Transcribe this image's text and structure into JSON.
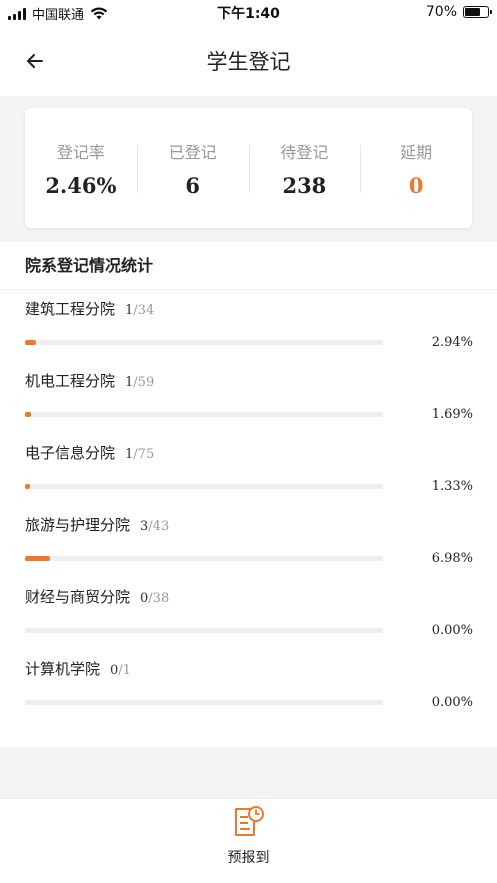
{
  "status_bar": {
    "carrier": "中国联通",
    "time": "下午1:40",
    "battery": "70%",
    "battery_level": 0.7
  },
  "nav": {
    "title": "学生登记",
    "back_icon": "arrow-left-icon"
  },
  "summary": {
    "rate_label": "登记率",
    "rate_value": "2.46%",
    "registered_label": "已登记",
    "registered_value": "6",
    "pending_label": "待登记",
    "pending_value": "238",
    "delayed_label": "延期",
    "delayed_value": "0",
    "accent_color": "#f0782a"
  },
  "departments": {
    "title": "院系登记情况统计",
    "items": [
      {
        "name": "建筑工程分院",
        "registered": "1",
        "total": "/34",
        "percent": "2.94%",
        "ratio": 0.0294
      },
      {
        "name": "机电工程分院",
        "registered": "1",
        "total": "/59",
        "percent": "1.69%",
        "ratio": 0.0169
      },
      {
        "name": "电子信息分院",
        "registered": "1",
        "total": "/75",
        "percent": "1.33%",
        "ratio": 0.0133
      },
      {
        "name": "旅游与护理分院",
        "registered": "3",
        "total": "/43",
        "percent": "6.98%",
        "ratio": 0.0698
      },
      {
        "name": "财经与商贸分院",
        "registered": "0",
        "total": "/38",
        "percent": "0.00%",
        "ratio": 0
      },
      {
        "name": "计算机学院",
        "registered": "0",
        "total": "/1",
        "percent": "0.00%",
        "ratio": 0
      }
    ]
  },
  "tabbar": {
    "label": "预报到",
    "icon": "document-clock-icon"
  }
}
